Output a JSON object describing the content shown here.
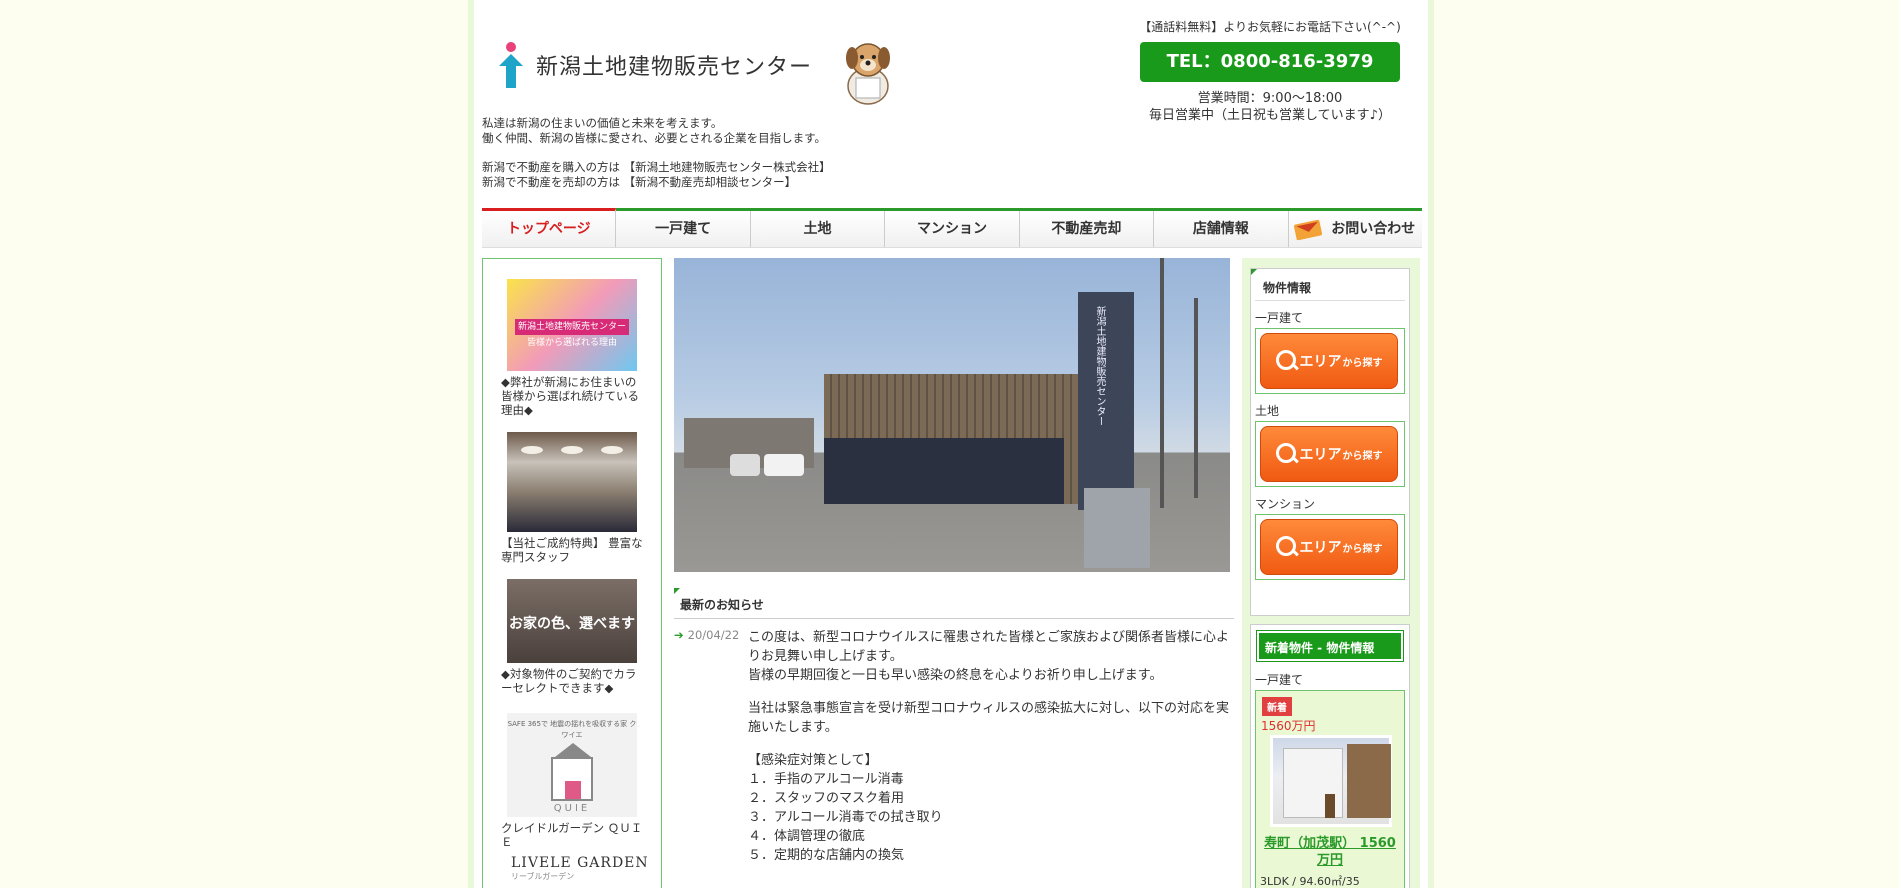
{
  "header": {
    "company_name": "新潟土地建物販売センター",
    "intro_line1": "私達は新潟の住まいの価値と未来を考えます。",
    "intro_line2": "働く仲間、新潟の皆様に愛され、必要とされる企業を目指します。",
    "intro_line3": "新潟で不動産を購入の方は 【新潟土地建物販売センター株式会社】",
    "intro_line4": "新潟で不動産を売却の方は 【新潟不動産売却相談センター】",
    "phone_note": "【通話料無料】よりお気軽にお電話下さい(^-^)",
    "phone_button": "TEL：0800-816-3979",
    "hours_line1": "営業時間：9:00～18:00",
    "hours_line2": "毎日営業中（土日祝も営業しています♪）"
  },
  "nav": {
    "top": "トップページ",
    "house": "一戸建て",
    "land": "土地",
    "mansion": "マンション",
    "sell": "不動産売却",
    "store": "店舗情報",
    "contact": "お問い合わせ"
  },
  "left": {
    "banner1_title": "新潟土地建物販売センター 皆様から選ばれる理由",
    "banner1_caption": "◆弊社が新潟にお住まいの皆様から選ばれ続けている理由◆",
    "banner2_caption": "【当社ご成約特典】 豊富な専門スタッフ",
    "banner3_title": "お家の色、選べます",
    "banner3_caption": "◆対象物件のご契約でカラーセレクトできます◆",
    "banner4_text": "SAFE 365で 地震の揺れを吸収する家 クワイエ",
    "banner4_logo": "QUIE",
    "banner4_caption": "クレイドルガーデン ＱＵＩＥ",
    "banner5_title": "LIVELE GARDEN",
    "banner5_sub": "リーブルガーデン"
  },
  "hero": {
    "sign_text": "新潟土地建物販売センター"
  },
  "news": {
    "heading": "最新のお知らせ",
    "date": "20/04/22",
    "p1": "この度は、新型コロナウイルスに罹患された皆様とご家族および関係者皆様に心よりお見舞い申し上げます。",
    "p2": "皆様の早期回復と一日も早い感染の終息を心よりお祈り申し上げます。",
    "p3": "当社は緊急事態宣言を受け新型コロナウィルスの感染拡大に対し、以下の対応を実施いたします。",
    "p4": "【感染症対策として】",
    "l1": "１．手指のアルコール消毒",
    "l2": "２．スタッフのマスク着用",
    "l3": "３．アルコール消毒での拭き取り",
    "l4": "４．体調管理の徹底",
    "l5": "５．定期的な店舗内の換気"
  },
  "right": {
    "prop_title": "物件情報",
    "house_label": "一戸建て",
    "land_label": "土地",
    "mansion_label": "マンション",
    "area_btn_main": "エリア",
    "area_btn_sub": "から探す",
    "new_title": "新着物件 - 物件情報",
    "new_label": "一戸建て",
    "new_badge": "新着",
    "new_price": "1560万円",
    "new_link": "寿町（加茂駅） 1560万円",
    "new_spec": "3LDK / 94.60㎡/35"
  },
  "colors": {
    "accent_green": "#1a9a1a",
    "accent_red": "#d81e1e",
    "area_orange": "#f05a12"
  }
}
